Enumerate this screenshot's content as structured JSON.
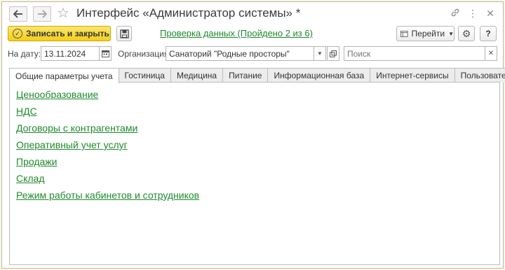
{
  "window": {
    "title": "Интерфейс «Администратор системы» *"
  },
  "toolbar": {
    "save_close_label": "Записать и закрыть",
    "check_link": "Проверка данных (Пройдено 2 из 6)",
    "goto_label": "Перейти",
    "help_label": "?"
  },
  "filters": {
    "date_label": "На дату:",
    "date_value": "13.11.2024",
    "org_label": "Организация:",
    "org_value": "Санаторий \"Родные просторы\"",
    "search_placeholder": "Поиск"
  },
  "tabs": [
    {
      "label": "Общие параметры учета",
      "active": true
    },
    {
      "label": "Гостиница",
      "active": false
    },
    {
      "label": "Медицина",
      "active": false
    },
    {
      "label": "Питание",
      "active": false
    },
    {
      "label": "Информационная база",
      "active": false
    },
    {
      "label": "Интернет-сервисы",
      "active": false
    },
    {
      "label": "Пользователи",
      "active": false
    }
  ],
  "links": [
    "Ценообразование",
    "НДС",
    "Договоры с контрагентами",
    "Оперативный учет услуг",
    "Продажи",
    "Склад",
    "Режим работы кабинетов и сотрудников"
  ],
  "colors": {
    "link": "#1f8a2c",
    "primary_button": "#f3cf16",
    "page_border": "#fbf6dc"
  }
}
